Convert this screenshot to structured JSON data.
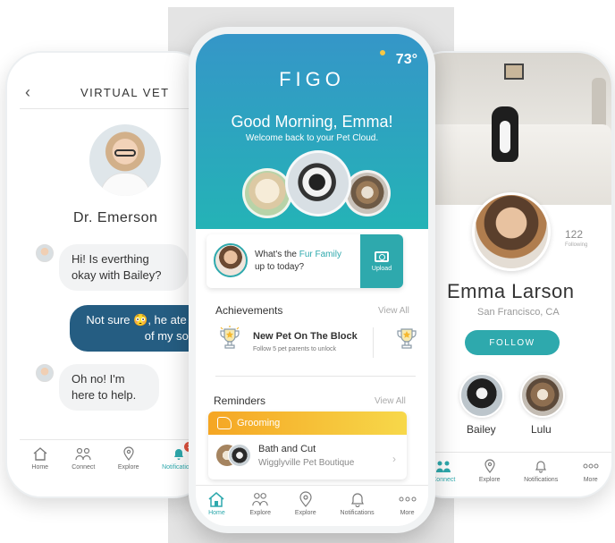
{
  "left_phone": {
    "header_title": "VIRTUAL VET",
    "back_glyph": "‹",
    "vet_name": "Dr. Emerson",
    "messages": [
      {
        "from": "vet",
        "text": "Hi! Is everthing okay with Bailey?"
      },
      {
        "from": "user",
        "text": "Not sure 😳, he ate one of my socks."
      },
      {
        "from": "vet",
        "text": "Oh no! I'm here to help."
      }
    ],
    "tabs": [
      {
        "label": "Home",
        "icon": "home-icon"
      },
      {
        "label": "Connect",
        "icon": "people-icon"
      },
      {
        "label": "Explore",
        "icon": "map-pin-icon"
      },
      {
        "label": "Notifications",
        "icon": "bell-icon",
        "badge": "2"
      }
    ]
  },
  "center_phone": {
    "temperature": "73°",
    "logo": "FIGO",
    "greeting": "Good Morning, Emma!",
    "subtitle": "Welcome back to your Pet Cloud.",
    "fur_family_card": {
      "text_before": "What's the ",
      "highlight": "Fur Family",
      "text_after": "up to today?",
      "upload_label": "Upload"
    },
    "achievements": {
      "title": "Achievements",
      "view_all": "View All",
      "item_title": "New Pet On The Block",
      "item_desc": "Follow 5 pet parents to unlock"
    },
    "reminders": {
      "title": "Reminders",
      "view_all": "View All",
      "category": "Grooming",
      "item_title": "Bath and Cut",
      "item_sub": "Wigglyville Pet Boutique"
    },
    "tabs": [
      {
        "label": "Home",
        "icon": "home-icon",
        "active": true
      },
      {
        "label": "Explore",
        "icon": "people-icon"
      },
      {
        "label": "Explore",
        "icon": "map-pin-icon"
      },
      {
        "label": "Notifications",
        "icon": "bell-icon"
      },
      {
        "label": "More",
        "icon": "more-icon"
      }
    ]
  },
  "right_phone": {
    "following_count": "122",
    "following_label": "Following",
    "name": "Emma Larson",
    "location": "San Francisco, CA",
    "follow_button": "FOLLOW",
    "pets": [
      "Bailey",
      "Lulu"
    ],
    "tabs": [
      {
        "label": "Connect",
        "icon": "people-icon",
        "active": true
      },
      {
        "label": "Explore",
        "icon": "map-pin-icon"
      },
      {
        "label": "Notifications",
        "icon": "bell-icon"
      },
      {
        "label": "More",
        "icon": "more-icon"
      }
    ]
  },
  "colors": {
    "teal": "#2ea9ad",
    "header_blue": "#3596c8",
    "bubble_blue": "#255d82",
    "reminder_orange": "#f5a623",
    "badge_red": "#e0523e"
  }
}
